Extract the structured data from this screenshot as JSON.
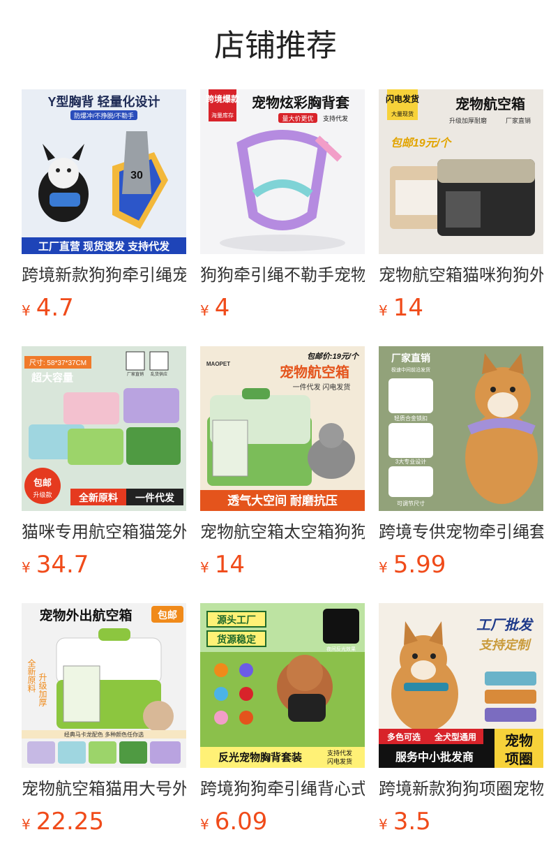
{
  "title": "店铺推荐",
  "currency": "¥",
  "products": [
    {
      "name": "跨境新款狗狗牵引绳宠物胸背",
      "price": "4.7",
      "image": {
        "banner_top": "Y型胸背 轻量化设计",
        "sub_top": "防爆冲/不挣脱/不勒手",
        "tag": "30",
        "banner_bottom": "工厂直营 现货速发 支持代发",
        "bg": "#e9eef5",
        "accent": "#2a4dbb"
      }
    },
    {
      "name": "狗狗牵引绳不勒手宠物胸背套",
      "price": "4",
      "image": {
        "corner_tag": "跨境爆款",
        "corner_sub": "海量库存",
        "banner_top": "宠物炫彩胸背套",
        "sub_top": "量大价更优",
        "sub_top2": "支持代发",
        "bg": "#f4f4f6",
        "accent": "#d8232a"
      }
    },
    {
      "name": "宠物航空箱猫咪狗狗外出箱",
      "price": "14",
      "image": {
        "corner_tag": "闪电发货",
        "corner_sub": "大量现货",
        "banner_top": "宠物航空箱",
        "sub_top": "升级加厚耐磨",
        "sub_top2": "厂家直销",
        "promo": "包邮19元/个",
        "bg": "#ece8e2",
        "accent": "#222222"
      }
    },
    {
      "name": "猫咪专用航空箱猫笼外出便携",
      "price": "34.7",
      "image": {
        "size_label": "尺寸: 58*37*37CM",
        "capacity": "超大容量",
        "icon1": "厂家直销",
        "icon2": "乱货供应",
        "badge": "包邮",
        "badge_sub": "升级款",
        "banner_bottom": "全新原料",
        "banner_bottom2": "一件代发",
        "bg": "#d9e6da",
        "accent": "#e53a1f"
      }
    },
    {
      "name": "宠物航空箱太空箱狗狗外出箱",
      "price": "14",
      "image": {
        "brand": "MAOPET",
        "promo": "包邮价:19元/个",
        "banner_top": "宠物航空箱",
        "sub_top": "一件代发 闪电发货",
        "banner_bottom": "透气大空间 耐磨抗压",
        "bg": "#f3ead8",
        "accent": "#e4541c"
      }
    },
    {
      "name": "跨境专供宠物牵引绳套装胸背",
      "price": "5.99",
      "image": {
        "banner_top": "厂家直销",
        "sub_top": "极速中间前沿发货",
        "feature1": "轻质合金锁扣",
        "feature2": "3大专业设计",
        "feature3": "可调节尺寸",
        "bg": "#7c8f6a",
        "accent": "#d8232a"
      }
    },
    {
      "name": "宠物航空箱猫用大号外出箱",
      "price": "22.25",
      "image": {
        "banner_top": "宠物外出航空箱",
        "badge": "包邮",
        "side1": "全新原料",
        "side2": "升级加厚",
        "strip": "经典马卡龙配色 多种颜色任你选",
        "bg": "#f2f2f2",
        "accent": "#f08a1a"
      }
    },
    {
      "name": "跨境狗狗牵引绳背心式宠物胸背",
      "price": "6.09",
      "image": {
        "banner_top": "源头工厂",
        "banner_top2": "货源稳定",
        "night": "夜间反光效果",
        "banner_bottom": "反光宠物胸背套装",
        "sub_bottom": "支持代发",
        "sub_bottom2": "闪电发货",
        "bg": "#8bc04b",
        "accent": "#1e6a2a"
      }
    },
    {
      "name": "跨境新款狗狗项圈宠物项圈",
      "price": "3.5",
      "image": {
        "banner_top": "工厂批发",
        "banner_top2": "支持定制",
        "tag1": "多色可选",
        "tag2": "全犬型通用",
        "banner_bottom": "服务中小批发商",
        "big1": "宠物",
        "big2": "项圈",
        "bg": "#f4efe6",
        "accent": "#1e3a8a"
      }
    }
  ]
}
